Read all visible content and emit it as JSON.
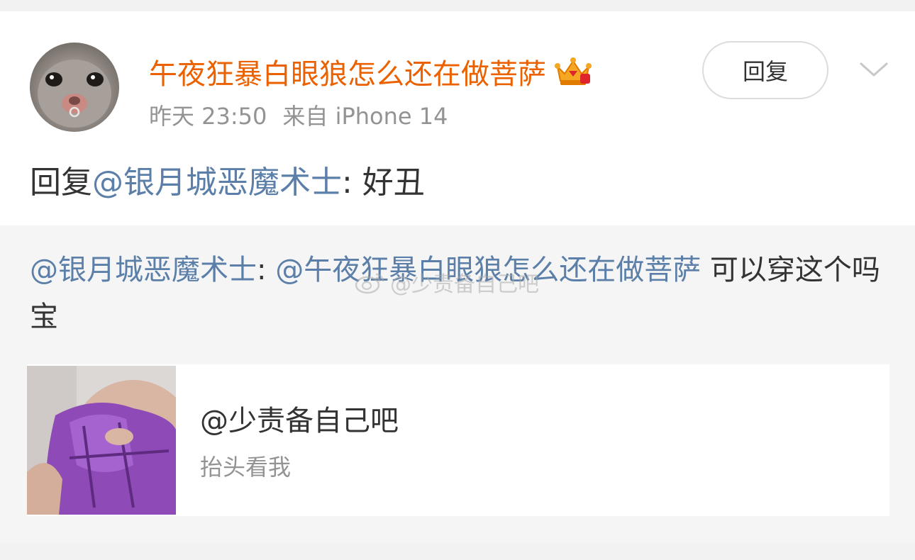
{
  "post": {
    "username": "午夜狂暴白眼狼怎么还在做菩萨",
    "time": "昨天 23:50",
    "source": "来自 iPhone 14",
    "reply_button_label": "回复",
    "reply_prefix": "回复 ",
    "reply_mention": "@银月城恶魔术士",
    "reply_body": ": 好丑"
  },
  "quoted": {
    "mention1": "@银月城恶魔术士",
    "sep": ": ",
    "mention2": "@午夜狂暴白眼狼怎么还在做菩萨",
    "body": " 可以穿这个吗宝",
    "watermark": "@少责备自己吧"
  },
  "card": {
    "title": "@少责备自己吧",
    "subtitle": "抬头看我"
  },
  "colors": {
    "username": "#eb6100",
    "mention": "#5b7fa8",
    "meta": "#939393",
    "text": "#333333"
  },
  "icons": {
    "badge": "crown-vip-icon",
    "menu": "chevron-down-icon",
    "watermark_logo": "weibo-logo-icon"
  }
}
